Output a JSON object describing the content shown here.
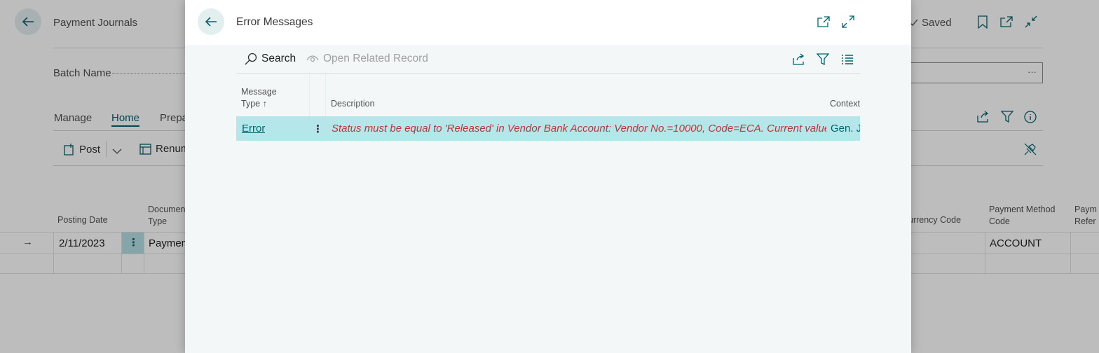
{
  "background": {
    "title": "Payment Journals",
    "saved_label": "Saved",
    "batch_name_label": "Batch Name",
    "batch_field_more": "···",
    "tabs": [
      "Manage",
      "Home",
      "Prepa"
    ],
    "actions": {
      "post": "Post",
      "renumber": "Renum"
    },
    "columns": {
      "posting_date": "Posting Date",
      "document_type_1": "Documen",
      "document_type_2": "Type",
      "currency_code": "urrency Code",
      "payment_method_1": "Payment Method",
      "payment_method_2": "Code",
      "payment_ref_1": "Paym",
      "payment_ref_2": "Refer"
    },
    "row": {
      "posting_date": "2/11/2023",
      "document_type": "Paymen",
      "payment_method": "ACCOUNT",
      "row_arrow": "→",
      "menu": "⋮"
    }
  },
  "dialog": {
    "title": "Error Messages",
    "toolbar": {
      "search": "Search",
      "open_related": "Open Related Record"
    },
    "columns": {
      "message_type_1": "Message",
      "message_type_2": "Type",
      "sort_arrow": "↑",
      "description": "Description",
      "context": "Context"
    },
    "rows": [
      {
        "message_type": "Error",
        "menu": "⋮",
        "description": "Status must be equal to 'Released'  in Vendor Bank Account: Vendor No.=10000, Code=ECA. Current value i...",
        "context": "Gen. Je"
      }
    ]
  },
  "colors": {
    "accent": "#00636d",
    "selected_row": "#b4e6ea",
    "error_text": "#b7373a"
  }
}
